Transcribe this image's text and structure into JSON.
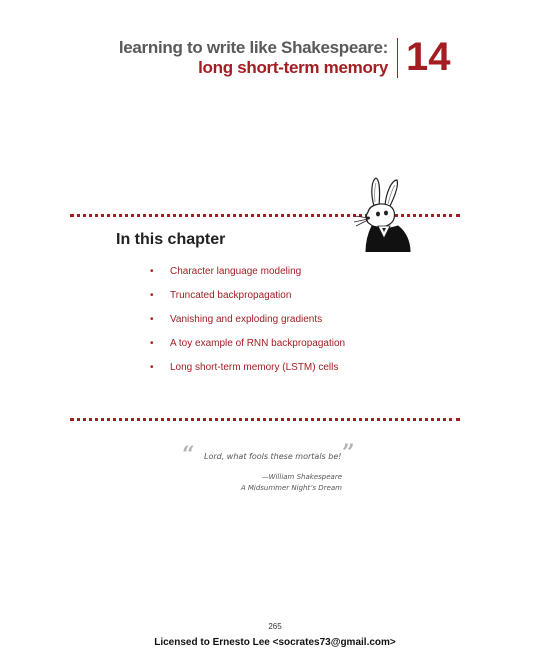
{
  "header": {
    "title_line1": "learning to write like Shakespeare:",
    "title_line2": "long short-term memory",
    "chapter_number": "14"
  },
  "section": {
    "heading": "In this chapter",
    "topics": [
      "Character language modeling",
      "Truncated backpropagation",
      "Vanishing and exploding gradients",
      "A toy example of RNN backpropagation",
      "Long short-term memory (LSTM) cells"
    ],
    "bullet": "•"
  },
  "epigraph": {
    "open_mark": "“",
    "text": "Lord, what fools these mortals be!",
    "close_mark": "”",
    "author": "—William Shakespeare",
    "work": "A Midsummer Night’s Dream"
  },
  "footer": {
    "page_number": "265",
    "license": "Licensed to Ernesto Lee <socrates73@gmail.com>"
  },
  "colors": {
    "accent": "#a31e22",
    "title_gray": "#5a5a5a"
  },
  "icons": {
    "mascot": "rabbit-in-suit-illustration"
  }
}
